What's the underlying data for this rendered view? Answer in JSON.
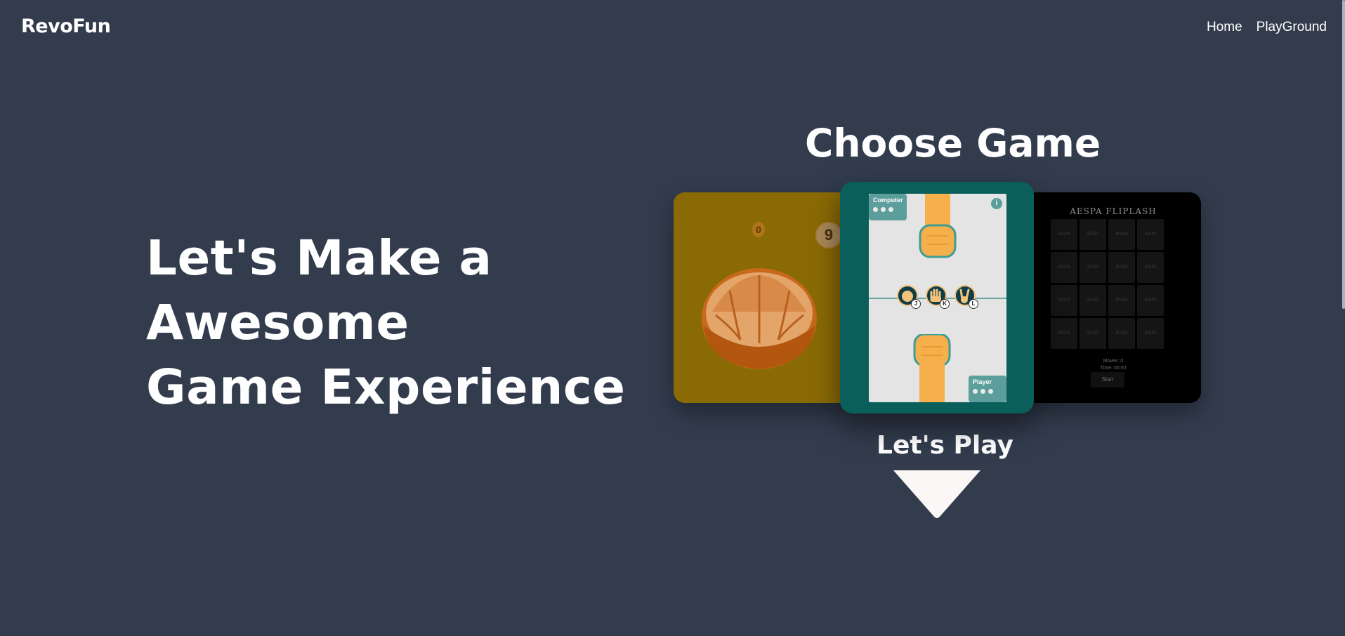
{
  "nav": {
    "brand": "RevoFun",
    "links": [
      {
        "label": "Home"
      },
      {
        "label": "PlayGround"
      }
    ]
  },
  "hero": {
    "lines": [
      "Let's Make a",
      "Awesome",
      "Game Experience"
    ]
  },
  "games": {
    "title": "Choose Game",
    "orange": {
      "counter_left": "0",
      "counter_right": "9"
    },
    "rps": {
      "computer_label": "Computer",
      "player_label": "Player",
      "info_icon": "i",
      "keys": [
        "J",
        "K",
        "L"
      ]
    },
    "memory": {
      "title": "AESPA FLIPLASH",
      "tile_text": "ÆSPA",
      "moves": "Moves: 0",
      "time": "Time: 00:00",
      "start_label": "Start"
    },
    "play_label": "Let's Play"
  },
  "colors": {
    "background": "#323c4d",
    "orange_card": "#8a6a05",
    "rps_card": "#0b5f5a",
    "memory_card": "#000000"
  }
}
